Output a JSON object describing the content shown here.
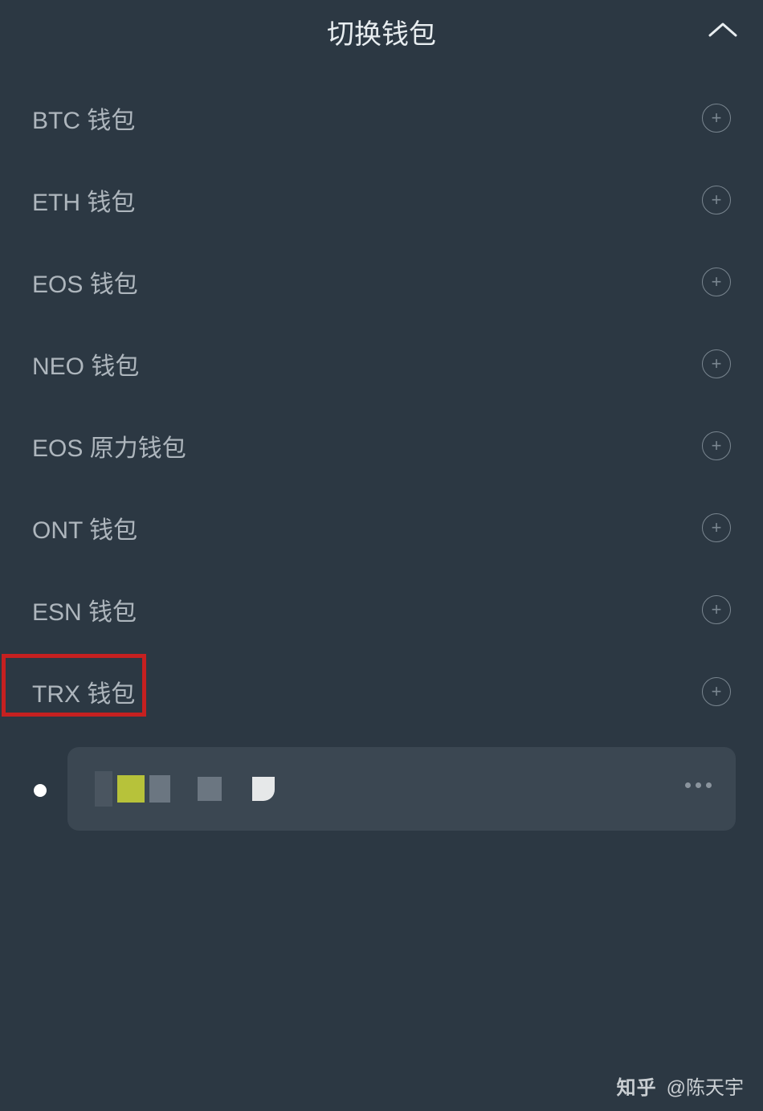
{
  "header": {
    "title": "切换钱包"
  },
  "wallets": [
    {
      "label": "BTC 钱包"
    },
    {
      "label": "ETH 钱包"
    },
    {
      "label": "EOS 钱包"
    },
    {
      "label": "NEO 钱包"
    },
    {
      "label": "EOS 原力钱包"
    },
    {
      "label": "ONT 钱包"
    },
    {
      "label": "ESN 钱包"
    },
    {
      "label": "TRX 钱包"
    }
  ],
  "watermark": {
    "logo": "知乎",
    "author": "@陈天宇"
  }
}
